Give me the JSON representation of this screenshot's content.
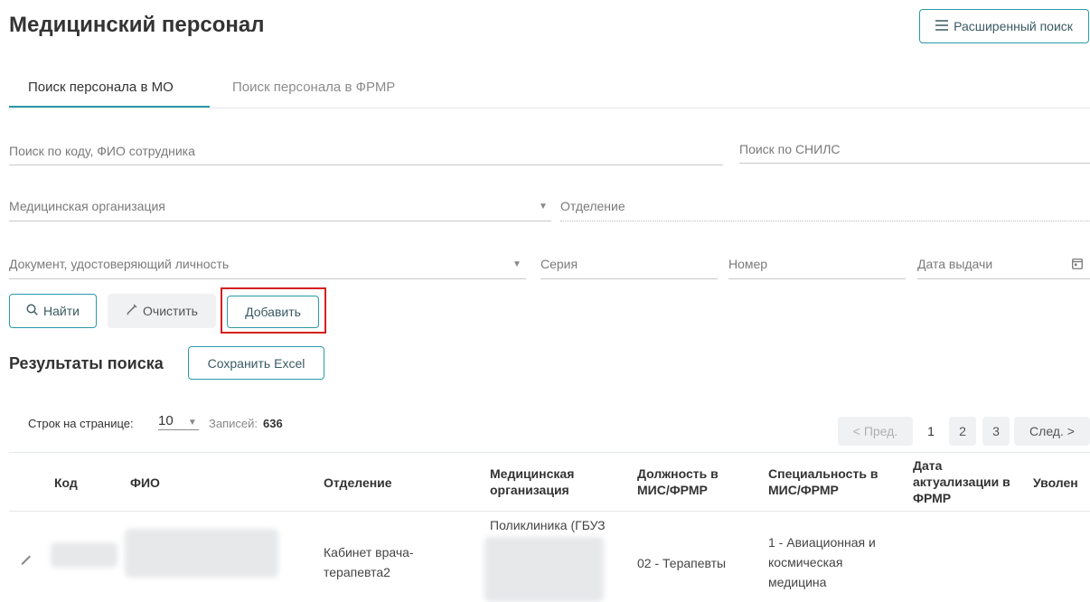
{
  "page": {
    "title": "Медицинский персонал"
  },
  "header": {
    "advanced_search_label": "Расширенный поиск",
    "advanced_search_icon": "menu-lines-icon"
  },
  "tabs": [
    {
      "label": "Поиск персонала в МО",
      "active": true
    },
    {
      "label": "Поиск персонала в ФРМР",
      "active": false
    }
  ],
  "filters": {
    "code_fio_placeholder": "Поиск по коду, ФИО сотрудника",
    "snils_placeholder": "Поиск по СНИЛС",
    "med_org_placeholder": "Медицинская организация",
    "department_placeholder": "Отделение",
    "document_placeholder": "Документ, удостоверяющий личность",
    "series_placeholder": "Серия",
    "number_placeholder": "Номер",
    "issue_date_placeholder": "Дата выдачи"
  },
  "actions": {
    "find_label": "Найти",
    "clear_label": "Очистить",
    "add_label": "Добавить"
  },
  "results": {
    "title": "Результаты поиска",
    "export_label": "Сохранить Excel",
    "rows_per_page_label": "Строк на странице:",
    "rows_per_page_value": "10",
    "records_label": "Записей:",
    "records_count": "636"
  },
  "pagination": {
    "prev_label": "< Пред.",
    "pages": [
      "1",
      "2",
      "3"
    ],
    "current_page": "1",
    "next_label": "След. >"
  },
  "table": {
    "columns": [
      "Код",
      "ФИО",
      "Отделение",
      "Медицинская организация",
      "Должность в МИС/ФРМР",
      "Специальность в МИС/ФРМР",
      "Дата актуализации в ФРМР",
      "Уволен"
    ],
    "rows": [
      {
        "department": "Кабинет врача-терапевта2",
        "organization": "Поликлиника (ГБУЗ",
        "position": "02 - Терапевты",
        "specialty": "1 - Авиационная и космическая медицина",
        "fired": ""
      }
    ]
  },
  "colors": {
    "accent": "#2a9aa8",
    "highlight": "#d32020",
    "muted_button": "#f0f1f2"
  }
}
